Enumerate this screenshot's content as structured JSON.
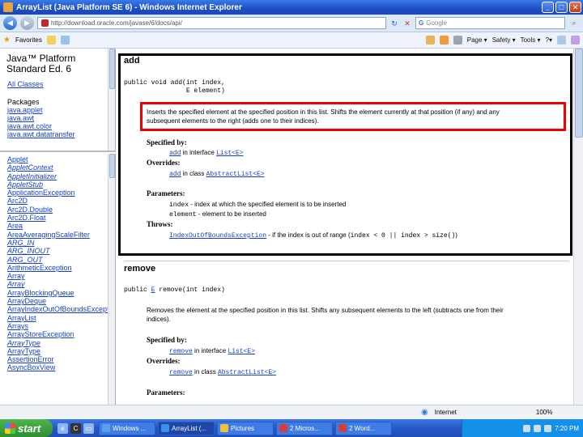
{
  "window": {
    "title": "ArrayList (Java Platform SE 6) - Windows Internet Explorer",
    "minimize": "_",
    "maximize": "□",
    "close": "✕"
  },
  "address_bar": {
    "url": "http://download.oracle.com/javase/6/docs/api/",
    "search_placeholder": "Google"
  },
  "toolbar": {
    "favorites": "Favorites",
    "page": "Page ▾",
    "safety": "Safety ▾",
    "tools": "Tools ▾",
    "help": "?▾"
  },
  "left_top": {
    "platform_line1": "Java™ Platform",
    "platform_line2": "Standard Ed. 6",
    "all_classes": "All Classes",
    "packages_label": "Packages",
    "packages": [
      "java.applet",
      "java.awt",
      "java.awt.color",
      "java.awt.datatransfer"
    ]
  },
  "left_bottom": {
    "classes": [
      {
        "name": "Applet",
        "italic": false
      },
      {
        "name": "AppletContext",
        "italic": true
      },
      {
        "name": "AppletInitializer",
        "italic": true
      },
      {
        "name": "AppletStub",
        "italic": true
      },
      {
        "name": "ApplicationException",
        "italic": false
      },
      {
        "name": "Arc2D",
        "italic": false
      },
      {
        "name": "Arc2D.Double",
        "italic": false
      },
      {
        "name": "Arc2D.Float",
        "italic": false
      },
      {
        "name": "Area",
        "italic": false
      },
      {
        "name": "AreaAveragingScaleFilter",
        "italic": false
      },
      {
        "name": "ARG_IN",
        "italic": true
      },
      {
        "name": "ARG_INOUT",
        "italic": true
      },
      {
        "name": "ARG_OUT",
        "italic": true
      },
      {
        "name": "ArithmeticException",
        "italic": false
      },
      {
        "name": "Array",
        "italic": false
      },
      {
        "name": "Array",
        "italic": true
      },
      {
        "name": "ArrayBlockingQueue",
        "italic": false
      },
      {
        "name": "ArrayDeque",
        "italic": false
      },
      {
        "name": "ArrayIndexOutOfBoundsException",
        "italic": false
      },
      {
        "name": "ArrayList",
        "italic": false
      },
      {
        "name": "Arrays",
        "italic": false
      },
      {
        "name": "ArrayStoreException",
        "italic": false
      },
      {
        "name": "ArrayType",
        "italic": true
      },
      {
        "name": "ArrayType",
        "italic": false
      },
      {
        "name": "AssertionError",
        "italic": false
      },
      {
        "name": "AsyncBoxView",
        "italic": false
      }
    ]
  },
  "main": {
    "add": {
      "heading": "add",
      "signature_line1": "public void add(int index,",
      "signature_line2": "                E element)",
      "description_line1": "Inserts the specified element at the specified position in this list. Shifts the element currently at that position (if any) and any",
      "description_line2": "subsequent elements to the right (adds one to their indices).",
      "specified_by_label": "Specified by:",
      "specified_by_method": "add",
      "specified_by_text": " in interface ",
      "specified_by_type": "List<E>",
      "overrides_label": "Overrides:",
      "overrides_method": "add",
      "overrides_text": " in class ",
      "overrides_type": "AbstractList<E>",
      "parameters_label": "Parameters:",
      "param1_name": "index",
      "param1_desc": " - index at which the specified element is to be inserted",
      "param2_name": "element",
      "param2_desc": " - element to be inserted",
      "throws_label": "Throws:",
      "throws_type": "IndexOutOfBoundsException",
      "throws_desc": " - if the index is out of range (",
      "throws_expr": "index < 0 || index > size()",
      "throws_end": ")"
    },
    "remove": {
      "heading": "remove",
      "signature_prefix": "public ",
      "signature_type": "E",
      "signature_rest": " remove(int index)",
      "description_line1": "Removes the element at the specified position in this list. Shifts any subsequent elements to the left (subtracts one from their",
      "description_line2": "indices).",
      "specified_by_label": "Specified by:",
      "specified_by_method": "remove",
      "specified_by_text": " in interface ",
      "specified_by_type": "List<E>",
      "overrides_label": "Overrides:",
      "overrides_method": "remove",
      "overrides_text": " in class ",
      "overrides_type": "AbstractList<E>",
      "parameters_label": "Parameters:"
    }
  },
  "statusbar": {
    "zone": "Internet",
    "zoom": "100%"
  },
  "taskbar": {
    "start": "start",
    "tasks": [
      {
        "label": "Windows ...",
        "color": "#5aa0f0"
      },
      {
        "label": "ArrayList (...",
        "color": "#3b8ff0"
      },
      {
        "label": "Pictures",
        "color": "#f0c040"
      },
      {
        "label": "2 Micros...",
        "color": "#d04040"
      },
      {
        "label": "2 Word...",
        "color": "#d04040"
      }
    ],
    "clock": "7:20 PM"
  },
  "colors": {
    "highlight_box": "#e00000",
    "link": "#1540c9",
    "titlebar": "#1c4fc4"
  }
}
